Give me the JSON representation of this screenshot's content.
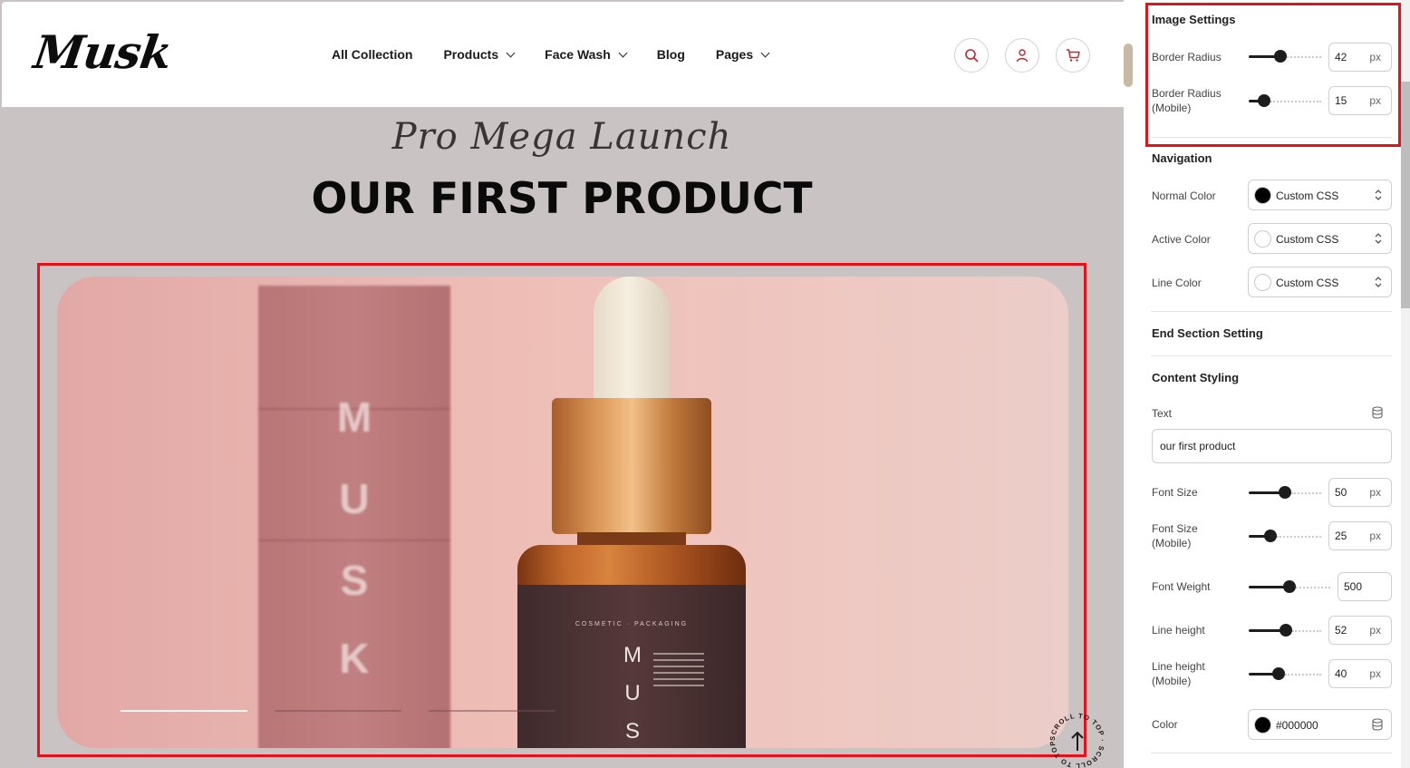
{
  "site": {
    "logo": "Musk",
    "nav": [
      {
        "label": "All Collection",
        "dropdown": false
      },
      {
        "label": "Products",
        "dropdown": true
      },
      {
        "label": "Face Wash",
        "dropdown": true
      },
      {
        "label": "Blog",
        "dropdown": false
      },
      {
        "label": "Pages",
        "dropdown": true
      }
    ],
    "header_icons": [
      "search-icon",
      "user-icon",
      "cart-icon"
    ],
    "hero": {
      "subtitle": "Pro Mega Launch",
      "title": "OUR FIRST PRODUCT",
      "package_letters": [
        "M",
        "U",
        "S",
        "K"
      ],
      "label_caption": "COSMETIC · PACKAGING",
      "label_letters": [
        "M",
        "U",
        "S"
      ],
      "slides": 3,
      "active_slide": 0
    },
    "scroll_top_label": "SCROLL TO TOP · SCROLL TO TOP ·"
  },
  "panel": {
    "image_settings": {
      "title": "Image Settings",
      "border_radius": {
        "label": "Border Radius",
        "value": "42",
        "unit": "px",
        "level": 0.42
      },
      "border_radius_mobile": {
        "label": "Border Radius (Mobile)",
        "value": "15",
        "unit": "px",
        "level": 0.15
      }
    },
    "navigation": {
      "title": "Navigation",
      "normal_color": {
        "label": "Normal Color",
        "value": "Custom CSS",
        "swatch": "#000000"
      },
      "active_color": {
        "label": "Active Color",
        "value": "Custom CSS",
        "swatch": "#ffffff"
      },
      "line_color": {
        "label": "Line Color",
        "value": "Custom CSS",
        "swatch": "#ffffff"
      }
    },
    "end_section": {
      "title": "End Section Setting"
    },
    "content_styling": {
      "title": "Content Styling",
      "text": {
        "label": "Text",
        "value": "our first product"
      },
      "font_size": {
        "label": "Font Size",
        "value": "50",
        "unit": "px",
        "level": 0.5
      },
      "font_size_mobile": {
        "label": "Font Size (Mobile)",
        "value": "25",
        "unit": "px",
        "level": 0.25
      },
      "font_weight": {
        "label": "Font Weight",
        "value": "500",
        "level": 0.5
      },
      "line_height": {
        "label": "Line height",
        "value": "52",
        "unit": "px",
        "level": 0.52
      },
      "line_height_mobile": {
        "label": "Line height (Mobile)",
        "value": "40",
        "unit": "px",
        "level": 0.4
      },
      "color": {
        "label": "Color",
        "value": "#000000",
        "swatch": "#000000"
      }
    }
  },
  "colors": {
    "highlight": "#e3121b",
    "accent": "#c0272d"
  }
}
